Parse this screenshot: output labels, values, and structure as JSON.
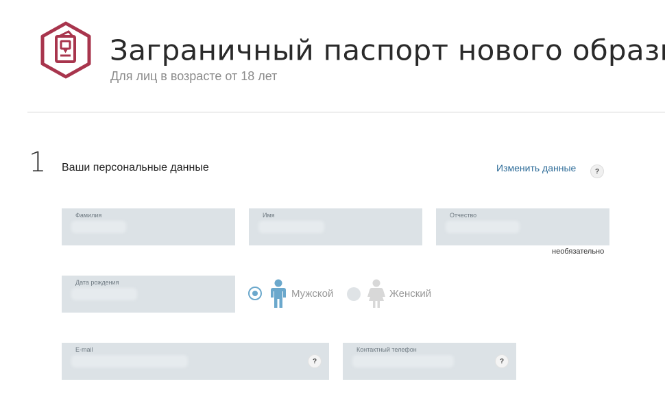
{
  "header": {
    "title": "Заграничный паспорт нового образца",
    "subtitle": "Для лиц в возрасте от 18 лет"
  },
  "section": {
    "number": "1",
    "title": "Ваши персональные данные",
    "edit_link": "Изменить данные",
    "help": "?"
  },
  "fields": {
    "last_name": {
      "label": "Фамилия",
      "value": ""
    },
    "first_name": {
      "label": "Имя",
      "value": ""
    },
    "middle_name": {
      "label": "Отчество",
      "value": "",
      "note": "необязательно"
    },
    "birth_date": {
      "label": "Дата рождения",
      "value": ""
    },
    "email": {
      "label": "E-mail",
      "value": "",
      "help": "?"
    },
    "phone": {
      "label": "Контактный телефон",
      "value": "",
      "help": "?"
    }
  },
  "gender": {
    "male": "Мужской",
    "female": "Женский",
    "selected": "male"
  },
  "colors": {
    "logo": "#a8354d",
    "field_bg": "#dce2e6",
    "link": "#2f6d99",
    "male_icon": "#6ba8cc",
    "female_icon": "#d8d8d8"
  },
  "icons": {
    "logo": "passport-hexagon-icon",
    "male": "male-figure-icon",
    "female": "female-figure-icon"
  }
}
